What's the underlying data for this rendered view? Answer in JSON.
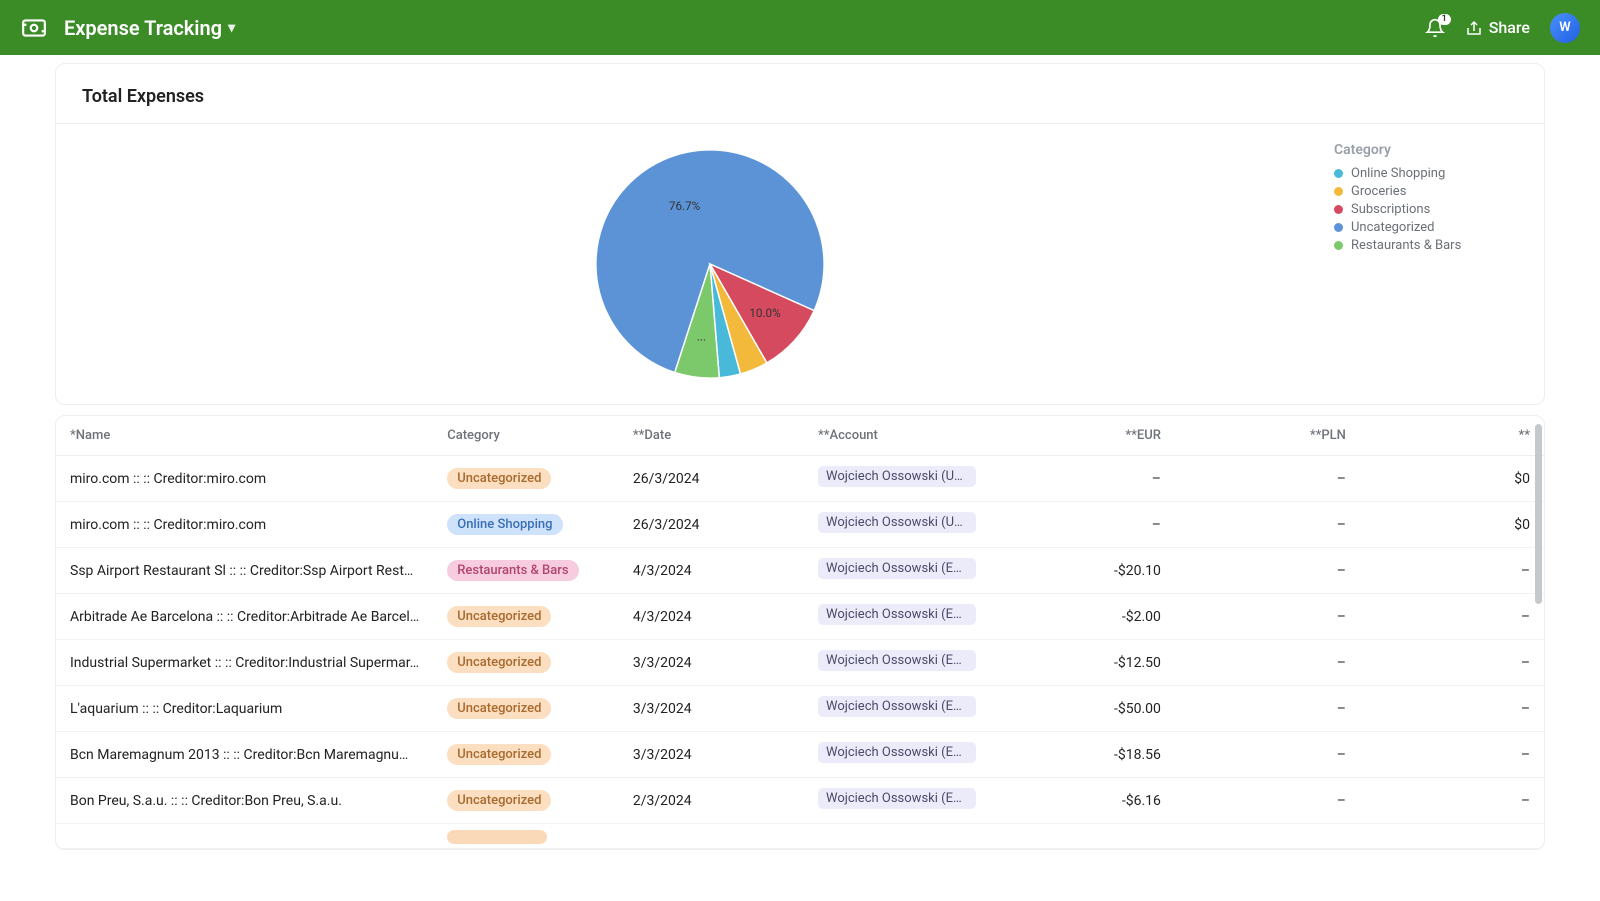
{
  "header": {
    "title": "Expense Tracking",
    "notification_count": "1",
    "share_label": "Share",
    "avatar_initial": "W"
  },
  "card": {
    "title": "Total Expenses"
  },
  "chart_data": {
    "type": "pie",
    "title": "Total Expenses",
    "legend_title": "Category",
    "series": [
      {
        "name": "Uncategorized",
        "value": 76.7,
        "label": "76.7%",
        "color": "#5b93d6"
      },
      {
        "name": "Subscriptions",
        "value": 10.0,
        "label": "10.0%",
        "color": "#d64a5f"
      },
      {
        "name": "Groceries",
        "value": 4.0,
        "label": "",
        "color": "#f2b93b"
      },
      {
        "name": "Online Shopping",
        "value": 3.0,
        "label": "",
        "color": "#49b9da"
      },
      {
        "name": "Restaurants & Bars",
        "value": 6.3,
        "label": "...",
        "color": "#7cc96c"
      }
    ],
    "legend_order": [
      "Online Shopping",
      "Groceries",
      "Subscriptions",
      "Uncategorized",
      "Restaurants & Bars"
    ]
  },
  "category_styles": {
    "Uncategorized": {
      "bg": "#fcdec0",
      "fg": "#a86a2e"
    },
    "Online Shopping": {
      "bg": "#cfe2fb",
      "fg": "#3a6fb5"
    },
    "Restaurants & Bars": {
      "bg": "#f8ccdf",
      "fg": "#b0456f"
    }
  },
  "table": {
    "columns": [
      "*Name",
      "Category",
      "**Date",
      "**Account",
      "**EUR",
      "**PLN",
      "**"
    ],
    "rows": [
      {
        "name": "miro.com :: :: Creditor:miro.com",
        "category": "Uncategorized",
        "date": "26/3/2024",
        "account": "Wojciech Ossowski (USD",
        "eur": "–",
        "pln": "–",
        "last": "$0"
      },
      {
        "name": "miro.com :: :: Creditor:miro.com",
        "category": "Online Shopping",
        "date": "26/3/2024",
        "account": "Wojciech Ossowski (USD",
        "eur": "–",
        "pln": "–",
        "last": "$0"
      },
      {
        "name": "Ssp Airport Restaurant Sl :: :: Creditor:Ssp Airport Resta...",
        "category": "Restaurants & Bars",
        "date": "4/3/2024",
        "account": "Wojciech Ossowski (EUR)",
        "eur": "-$20.10",
        "pln": "–",
        "last": "–"
      },
      {
        "name": "Arbitrade Ae Barcelona :: :: Creditor:Arbitrade Ae Barcel...",
        "category": "Uncategorized",
        "date": "4/3/2024",
        "account": "Wojciech Ossowski (EUR)",
        "eur": "-$2.00",
        "pln": "–",
        "last": "–"
      },
      {
        "name": "Industrial Supermarket :: :: Creditor:Industrial Supermar...",
        "category": "Uncategorized",
        "date": "3/3/2024",
        "account": "Wojciech Ossowski (EUR)",
        "eur": "-$12.50",
        "pln": "–",
        "last": "–"
      },
      {
        "name": "L'aquarium :: :: Creditor:Laquarium",
        "category": "Uncategorized",
        "date": "3/3/2024",
        "account": "Wojciech Ossowski (EUR)",
        "eur": "-$50.00",
        "pln": "–",
        "last": "–"
      },
      {
        "name": "Bcn Maremagnum 2013 :: :: Creditor:Bcn Maremagnum ...",
        "category": "Uncategorized",
        "date": "3/3/2024",
        "account": "Wojciech Ossowski (EUR)",
        "eur": "-$18.56",
        "pln": "–",
        "last": "–"
      },
      {
        "name": "Bon Preu, S.a.u. :: :: Creditor:Bon Preu, S.a.u.",
        "category": "Uncategorized",
        "date": "2/3/2024",
        "account": "Wojciech Ossowski (EUR)",
        "eur": "-$6.16",
        "pln": "–",
        "last": "–"
      }
    ]
  }
}
